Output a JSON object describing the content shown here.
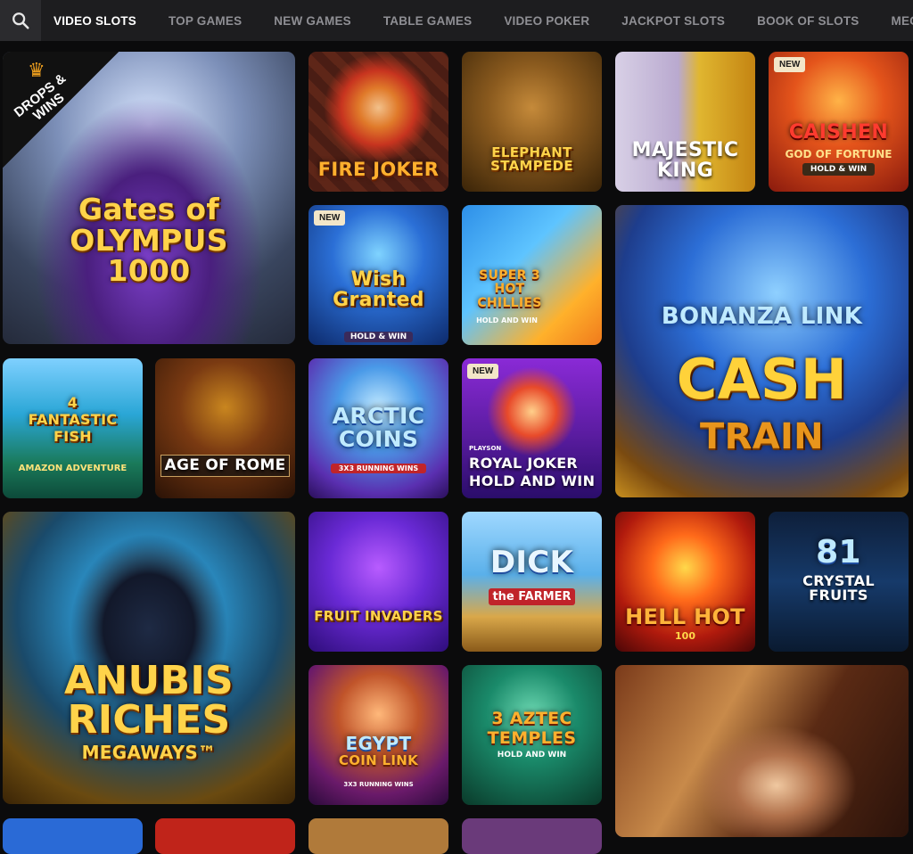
{
  "nav": {
    "search_icon": "search-icon",
    "items": [
      "VIDEO SLOTS",
      "TOP GAMES",
      "NEW GAMES",
      "TABLE GAMES",
      "VIDEO POKER",
      "JACKPOT SLOTS",
      "BOOK OF SLOTS",
      "MEGAWAYS SLO"
    ],
    "active_index": 0
  },
  "badges": {
    "new": "NEW"
  },
  "promo": {
    "drops_wins": "DROPS & WINS"
  },
  "games": {
    "gates": {
      "title": "Gates of OLYMPUS 1000"
    },
    "fire_joker": {
      "title": "FIRE JOKER"
    },
    "elephant": {
      "title": "ELEPHANT STAMPEDE"
    },
    "majestic": {
      "title": "MAJESTIC KING"
    },
    "caishen": {
      "title": "CAISHEN",
      "subtitle": "GOD OF FORTUNE",
      "tag": "HOLD & WIN"
    },
    "wish": {
      "title": "Wish Granted",
      "tag": "HOLD & WIN"
    },
    "chillies": {
      "title": "SUPER 3 HOT CHILLIES",
      "tag": "HOLD AND WIN"
    },
    "bonanza": {
      "title": "BONANZA LINK",
      "subtitle": "CASH",
      "subtitle2": "TRAIN"
    },
    "fish": {
      "title": "4 FANTASTIC FISH",
      "subtitle": "AMAZON ADVENTURE"
    },
    "rome": {
      "title": "AGE OF ROME"
    },
    "arctic": {
      "title": "ARCTIC COINS",
      "tag": "3X3 RUNNING WINS"
    },
    "royal": {
      "title": "ROYAL JOKER",
      "subtitle": "HOLD AND WIN",
      "provider": "PLAYSON"
    },
    "anubis": {
      "title": "ANUBIS",
      "subtitle": "RICHES",
      "tag": "MEGAWAYS™"
    },
    "fruit": {
      "title": "FRUIT INVADERS"
    },
    "dick": {
      "title": "DICK",
      "subtitle": "the FARMER"
    },
    "hellhot": {
      "title": "HELL HOT",
      "tag": "100"
    },
    "crystal": {
      "title": "81",
      "subtitle": "CRYSTAL FRUITS"
    },
    "egypt": {
      "title": "EGYPT",
      "subtitle": "COIN LINK",
      "tag": "3X3 RUNNING WINS"
    },
    "aztec": {
      "title": "3 AZTEC TEMPLES",
      "tag": "HOLD AND WIN"
    }
  }
}
